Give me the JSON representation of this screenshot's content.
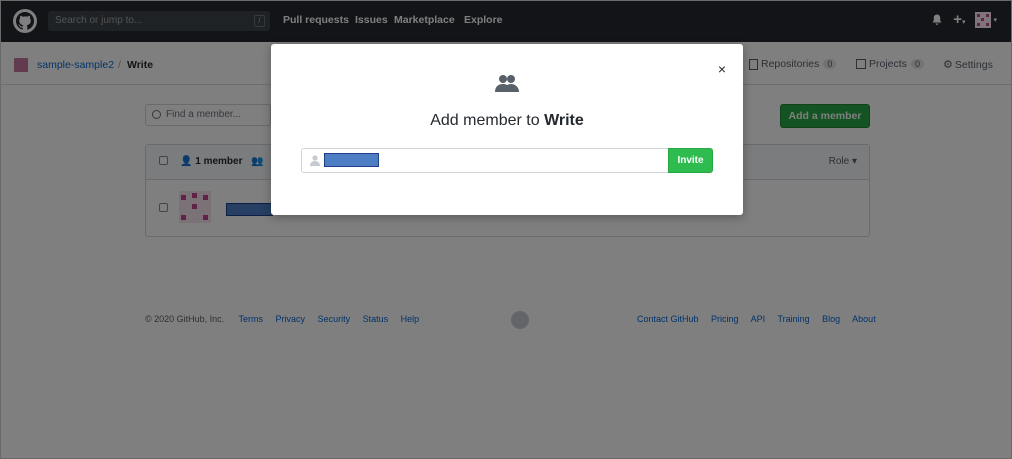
{
  "header": {
    "search_placeholder": "Search or jump to...",
    "search_shortcut": "/",
    "nav": [
      "Pull requests",
      "Issues",
      "Marketplace",
      "Explore"
    ]
  },
  "subheader": {
    "org": "sample-sample2",
    "separator": "/",
    "team": "Write",
    "tabs": [
      {
        "label": "Repositories",
        "count": "0"
      },
      {
        "label": "Projects",
        "count": "0"
      },
      {
        "label": "Settings",
        "count": ""
      }
    ]
  },
  "members": {
    "find_placeholder": "Find a member...",
    "add_button": "Add a member",
    "member_count": "1 member",
    "role_label": "Role ▾"
  },
  "footer": {
    "copyright": "© 2020 GitHub, Inc.",
    "left_links": [
      "Terms",
      "Privacy",
      "Security",
      "Status",
      "Help"
    ],
    "right_links": [
      "Contact GitHub",
      "Pricing",
      "API",
      "Training",
      "Blog",
      "About"
    ]
  },
  "modal": {
    "title_prefix": "Add member to",
    "title_team": "Write",
    "close_glyph": "×",
    "invite_button": "Invite"
  },
  "colors": {
    "header_bg": "#24292e",
    "primary_green": "#28a745",
    "link_blue": "#0366d6"
  }
}
